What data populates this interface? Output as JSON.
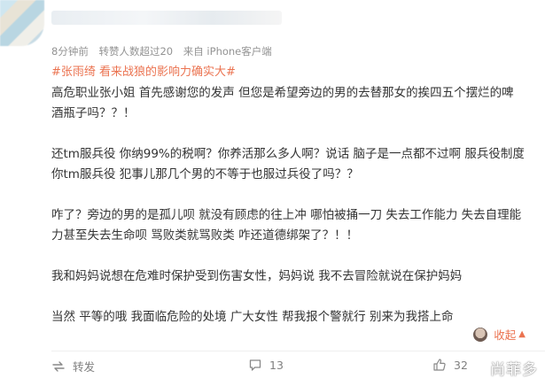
{
  "post": {
    "meta": {
      "time": "8分钟前",
      "reposts": "转赞人数超过20",
      "source": "来自 iPhone客户端"
    },
    "hashtag": "#张雨绮 看来战狼的影响力确实大#",
    "paragraphs": [
      "高危职业张小姐 首先感谢您的发声 但您是希望旁边的男的去替那女的挨四五个摆烂的啤酒瓶子吗？？！",
      "还tm服兵役 你纳99%的税啊？你养活那么多人啊？说话 脑子是一点都不过啊 服兵役制度 你tm服兵役 犯事儿那几个男的不等于也服过兵役了吗？？",
      "咋了？旁边的男的是孤儿呗 就没有顾虑的往上冲 哪怕被捅一刀 失去工作能力 失去自理能力甚至失去生命呗 骂败类就骂败类 咋还道德绑架了？！！",
      "我和妈妈说想在危难时保护受到伤害女性，妈妈说 我不去冒险就说在保护妈妈",
      "当然 平等的哦 我面临危险的处境 广大女性 帮我报个警就行 别来为我搭上命"
    ],
    "collapse_label": "收起",
    "actions": {
      "repost_label": "转发",
      "comment_count": "13",
      "like_count": "32"
    }
  },
  "watermark": "尚菲多",
  "colors": {
    "accent": "#eb7350",
    "meta_gray": "#939393",
    "text": "#333333"
  }
}
